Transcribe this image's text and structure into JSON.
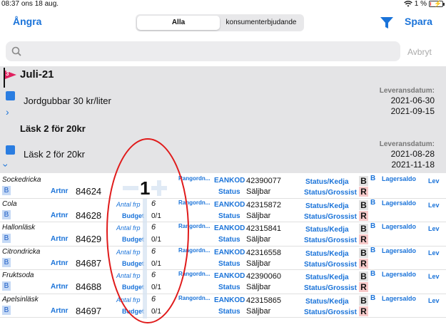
{
  "status_bar": {
    "time": "08:37",
    "date": "ons 18 aug.",
    "battery": "1 %",
    "battery_level": 0.01
  },
  "navbar": {
    "undo_label": "Ångra",
    "save_label": "Spara",
    "segments": [
      "Alla",
      "konsumenterbjudande"
    ],
    "active_segment": "Alla"
  },
  "search": {
    "value": "",
    "placeholder": "",
    "cancel_label": "Avbryt"
  },
  "campaign": {
    "flag_number": "3",
    "title": "Juli-21",
    "offers": [
      {
        "name": "Jordgubbar 30 kr/liter",
        "lev_label": "Leveransdatum:",
        "date_from": "2021-06-30",
        "date_to": "2021-09-15"
      },
      {
        "heading": "Läsk 2 för 20kr",
        "name": "Läsk 2 för 20kr",
        "lev_label": "Leveransdatum:",
        "date_from": "2021-08-28",
        "date_to": "2021-11-18"
      }
    ]
  },
  "labels": {
    "badge_b": "B",
    "artnr": "Artnr",
    "antal": "Antal frp",
    "budget": "Budget",
    "rang": "Rangordn...",
    "eankod": "EANKOD",
    "status": "Status",
    "kedja": "Status/Kedja",
    "grossist": "Status/Grossist",
    "big_b": "B",
    "big_r": "R",
    "small_b": "B",
    "lagersaldo": "Lagersaldo",
    "lev_cut": "Lev"
  },
  "stepper_count": "1",
  "products": [
    {
      "name": "Sockedricka",
      "artnr": "84624",
      "antal": "",
      "budget": "",
      "eankod": "42390077",
      "status": "Säljbar"
    },
    {
      "name": "Cola",
      "artnr": "84628",
      "antal": "6",
      "budget": "0/1",
      "eankod": "42315872",
      "status": "Säljbar"
    },
    {
      "name": "Hallonläsk",
      "artnr": "84629",
      "antal": "6",
      "budget": "0/1",
      "eankod": "42315841",
      "status": "Säljbar"
    },
    {
      "name": "Citrondricka",
      "artnr": "84687",
      "antal": "6",
      "budget": "0/1",
      "eankod": "42316558",
      "status": "Säljbar"
    },
    {
      "name": "Fruktsoda",
      "artnr": "84688",
      "antal": "6",
      "budget": "0/1",
      "eankod": "42390060",
      "status": "Säljbar"
    },
    {
      "name": "Apelsinläsk",
      "artnr": "84697",
      "antal": "6",
      "budget": "0/1",
      "eankod": "42315865",
      "status": "Säljbar"
    }
  ]
}
